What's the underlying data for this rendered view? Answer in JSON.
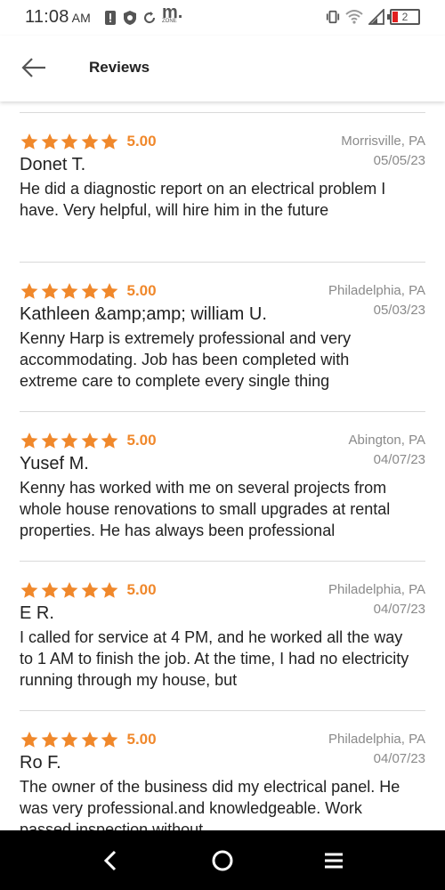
{
  "status_bar": {
    "time": "11:08",
    "ampm": "AM",
    "mzone_logo": "m.",
    "mzone_sub": "ZONE",
    "battery_level": "2",
    "icons": [
      "notification-icon",
      "shield-icon",
      "sync-icon",
      "vibrate-icon",
      "wifi-icon",
      "signal-icon",
      "battery-icon"
    ]
  },
  "header": {
    "title": "Reviews",
    "back_icon": "arrow-left-icon"
  },
  "colors": {
    "star": "#f0882b",
    "rating_text": "#f0882b",
    "muted": "#8a8a8a"
  },
  "reviews": [
    {
      "stars": 5,
      "rating": "5.00",
      "reviewer": "Donet T.",
      "location": "Morrisville, PA",
      "date": "05/05/23",
      "text": "He did a diagnostic report on an electrical problem I have. Very helpful, will hire him in the future"
    },
    {
      "stars": 5,
      "rating": "5.00",
      "reviewer": "Kathleen &amp;amp; william U.",
      "location": "Philadelphia, PA",
      "date": "05/03/23",
      "text": "Kenny Harp is extremely professional and very accommodating. Job has been completed with extreme care to complete every single thing"
    },
    {
      "stars": 5,
      "rating": "5.00",
      "reviewer": "Yusef M.",
      "location": "Abington, PA",
      "date": "04/07/23",
      "text": "Kenny has worked with me on several projects from whole house renovations to small upgrades at rental properties. He has always been professional"
    },
    {
      "stars": 5,
      "rating": "5.00",
      "reviewer": "E R.",
      "location": "Philadelphia, PA",
      "date": "04/07/23",
      "text": "I called for service at 4 PM, and he worked all the way to 1 AM to finish the job. At the time, I had no electricity running through my house, but"
    },
    {
      "stars": 5,
      "rating": "5.00",
      "reviewer": "Ro F.",
      "location": "Philadelphia, PA",
      "date": "04/07/23",
      "text": "The owner of the business did my electrical panel. He was very professional.and knowledgeable. Work passed inspection without"
    }
  ],
  "nav_bar": {
    "icons": [
      "back-nav-icon",
      "home-nav-icon",
      "menu-nav-icon"
    ]
  }
}
